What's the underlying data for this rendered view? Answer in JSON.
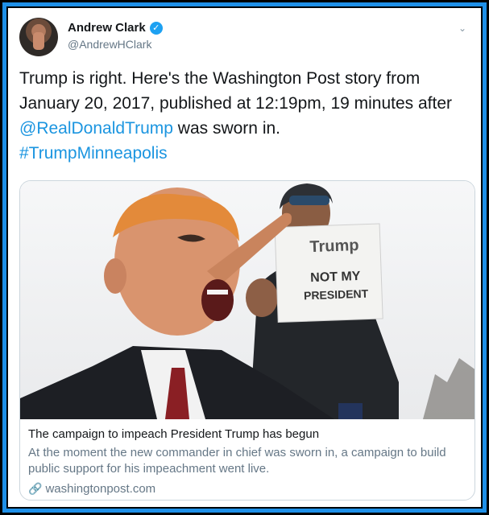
{
  "user": {
    "display_name": "Andrew Clark",
    "handle": "@AndrewHClark",
    "verified_glyph": "✓",
    "caret_glyph": "⌄"
  },
  "tweet": {
    "text_before": "Trump is right. Here's the Washington Post story from January 20, 2017, published at 12:19pm, 19 minutes after ",
    "mention": "@RealDonaldTrump",
    "text_after": " was sworn in.",
    "hashtag": "#TrumpMinneapolis"
  },
  "card": {
    "sign_line1": "Trump",
    "sign_line2": "NOT MY",
    "sign_line3": "PRESIDENT",
    "title": "The campaign to impeach President Trump has begun",
    "description": "At the moment the new commander in chief was sworn in, a campaign to build public support for his impeachment went live.",
    "domain": "washingtonpost.com",
    "link_glyph": "🔗"
  },
  "colors": {
    "link_blue": "#1b95e0",
    "frame_blue": "#1e90e8",
    "verified_blue": "#1da1f2"
  }
}
